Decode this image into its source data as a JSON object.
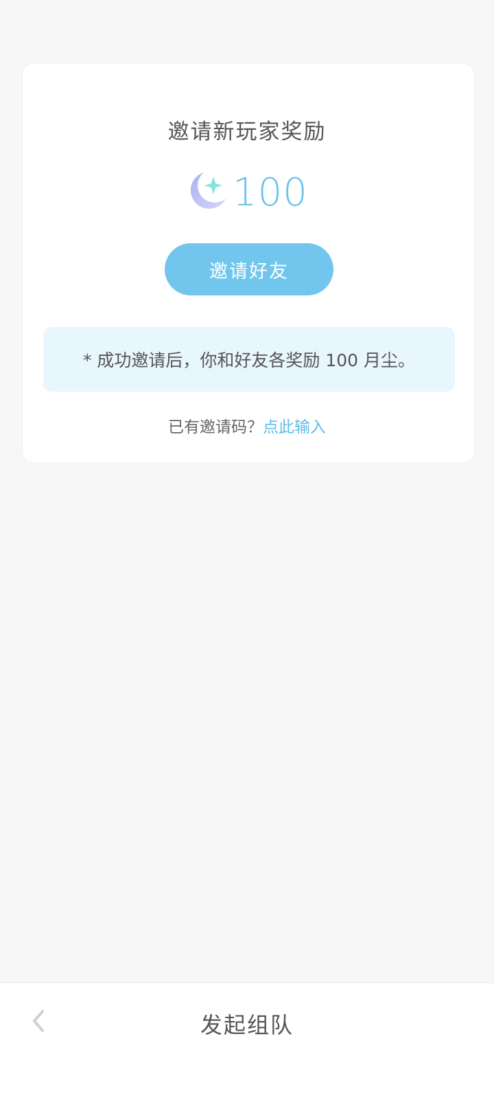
{
  "card": {
    "title": "邀请新玩家奖励",
    "reward": {
      "icon": "moon-star-icon",
      "amount": "100"
    },
    "invite_button": "邀请好友",
    "notice": "* 成功邀请后，你和好友各奖励 100 月尘。",
    "code_prompt": "已有邀请码？",
    "code_link": "点此输入"
  },
  "bottom_bar": {
    "back_icon": "chevron-left-icon",
    "title": "发起组队"
  },
  "colors": {
    "accent": "#72c6ee",
    "link": "#5bbde9",
    "notice_bg": "#e8f6fd",
    "page_bg": "#f7f7f8"
  }
}
